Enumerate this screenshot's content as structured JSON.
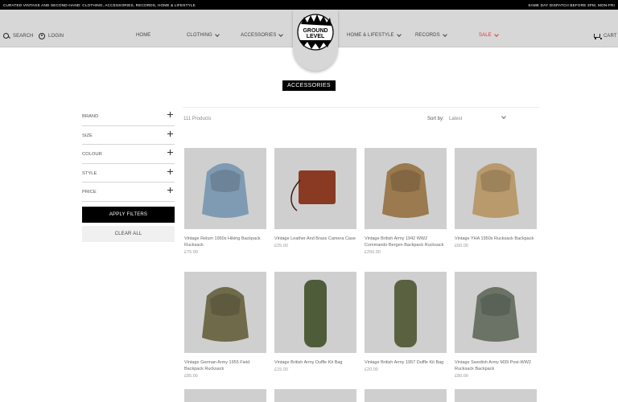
{
  "topbar": {
    "left": "CURATED VINTAGE AND SECOND-HAND: CLOTHING, ACCESSORIES, RECORDS, HOME & LIFESTYLE",
    "right": "SAME DAY DISPATCH BEFORE 3PM, MON-FRI"
  },
  "header": {
    "search": "SEARCH",
    "login": "LOGIN",
    "nav": [
      "HOME",
      "CLOTHING",
      "ACCESSORIES",
      "HOME & LIFESTYLE",
      "RECORDS",
      "SALE"
    ],
    "cart": "CART",
    "logo_text": "GROUND LEVEL",
    "sale_color": "#d23b3b"
  },
  "page_title": "ACCESSORIES",
  "filters": {
    "items": [
      "BRAND",
      "SIZE",
      "COLOUR",
      "STYLE",
      "PRICE"
    ],
    "apply": "APPLY FILTERS",
    "clear": "CLEAR ALL"
  },
  "products_header": {
    "count": "111 Products",
    "sort_label": "Sort by:",
    "sort_value": "Latest"
  },
  "products": [
    {
      "name": "Vintage Relum 1950s Hiking Backpack Rucksack",
      "price": "£75.00",
      "color": "#7f9bb3"
    },
    {
      "name": "Vintage Leather And Brass Camera Case",
      "price": "£25.00",
      "color": "#8a3a22"
    },
    {
      "name": "Vintage British Army 1942 WW2 Commando Bergen Backpack Rucksack",
      "price": "£250.00",
      "color": "#9a7a4e"
    },
    {
      "name": "Vintage YHA 1950s Rucksack Backpack",
      "price": "£60.00",
      "color": "#b89a6c"
    },
    {
      "name": "Vintage German Army 1955 Field Backpack Rucksack",
      "price": "£85.00",
      "color": "#6f6a4a"
    },
    {
      "name": "Vintage British Army Duffle Kit Bag",
      "price": "£15.00",
      "color": "#4f5c3a"
    },
    {
      "name": "Vintage British Army 1957 Duffle Kit Bag",
      "price": "£20.00",
      "color": "#5a6140"
    },
    {
      "name": "Vintage Swedish Army M39 Post-WW2 Rucksack Backpack",
      "price": "£80.00",
      "color": "#6a7366"
    }
  ]
}
